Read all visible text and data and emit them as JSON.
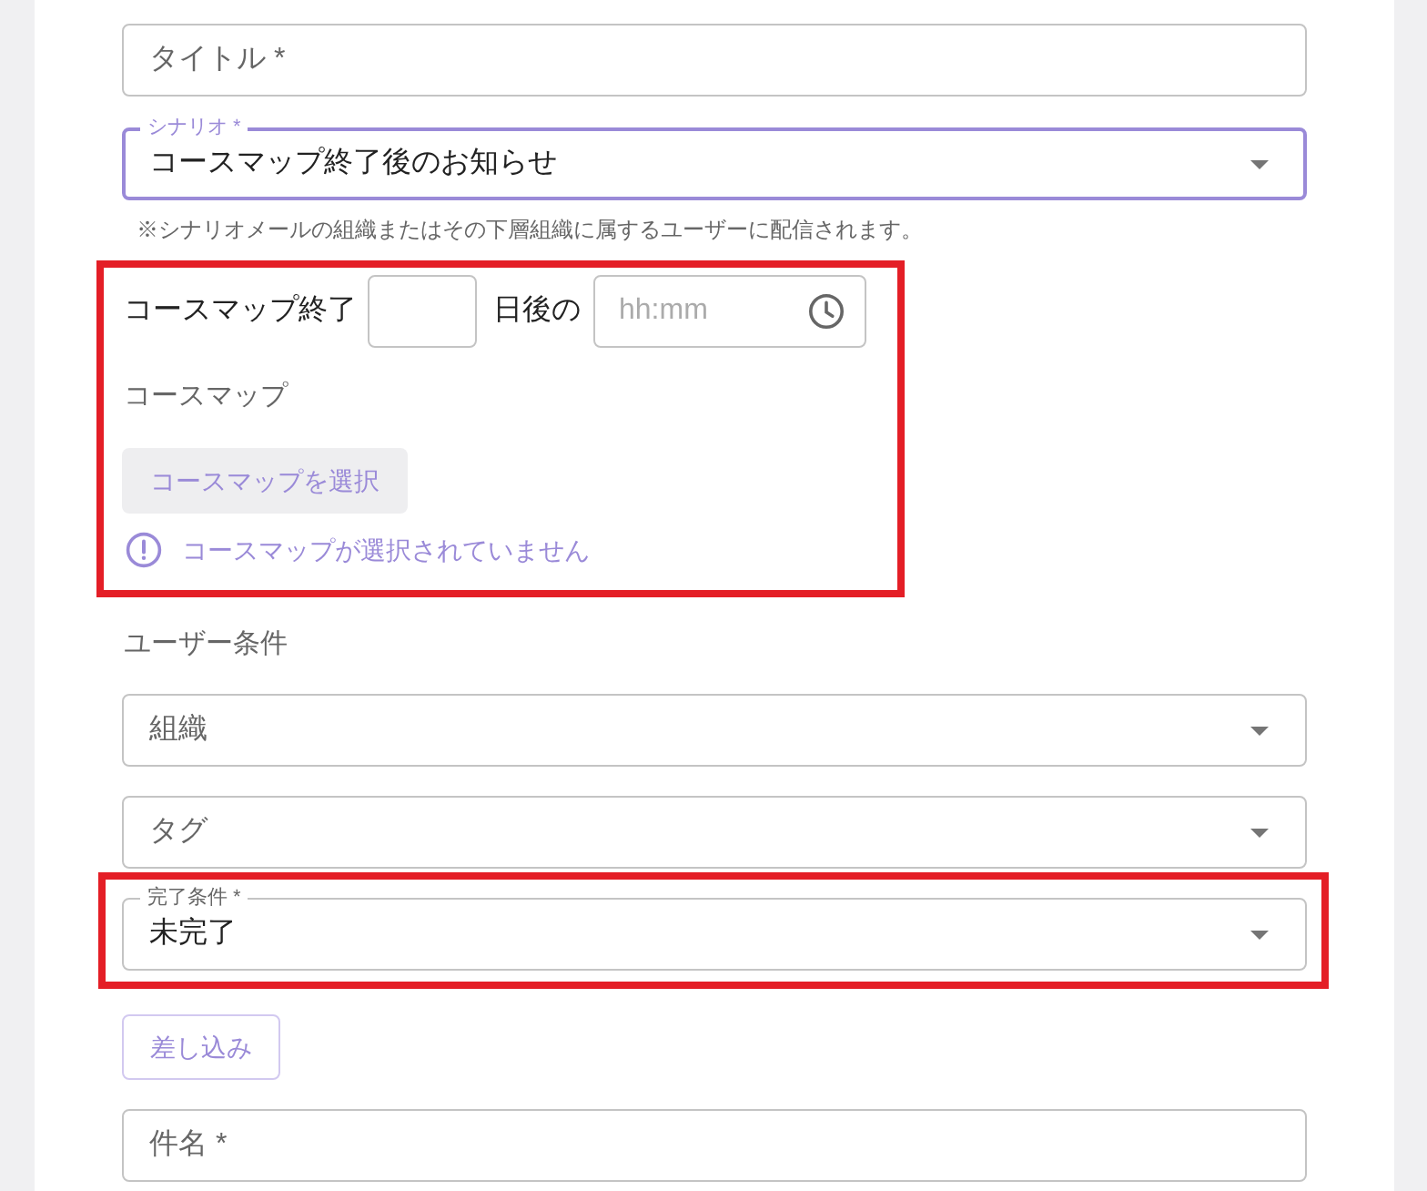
{
  "title_field": {
    "label": "タイトル *"
  },
  "scenario_select": {
    "label": "シナリオ *",
    "value": "コースマップ終了後のお知らせ",
    "focused": true
  },
  "scenario_note": "※シナリオメールの組織またはその下層組織に属するユーザーに配信されます。",
  "course_map_section": {
    "highlighted": true,
    "days_prefix": "コースマップ終了",
    "days_suffix": "日後の",
    "time_field": {
      "placeholder": "hh:mm"
    },
    "course_map_label": "コースマップ",
    "select_button": {
      "label": "コースマップを選択"
    },
    "error_message": "コースマップが選択されていません"
  },
  "user_conditions": {
    "heading": "ユーザー条件",
    "selects": [
      {
        "label": "組織"
      },
      {
        "label": "タグ"
      }
    ]
  },
  "completion_select": {
    "label": "完了条件 *",
    "value": "未完了",
    "focused": false,
    "highlighted": true
  },
  "insert_button": {
    "label": "差し込み"
  },
  "subject_field": {
    "label": "件名 *"
  }
}
